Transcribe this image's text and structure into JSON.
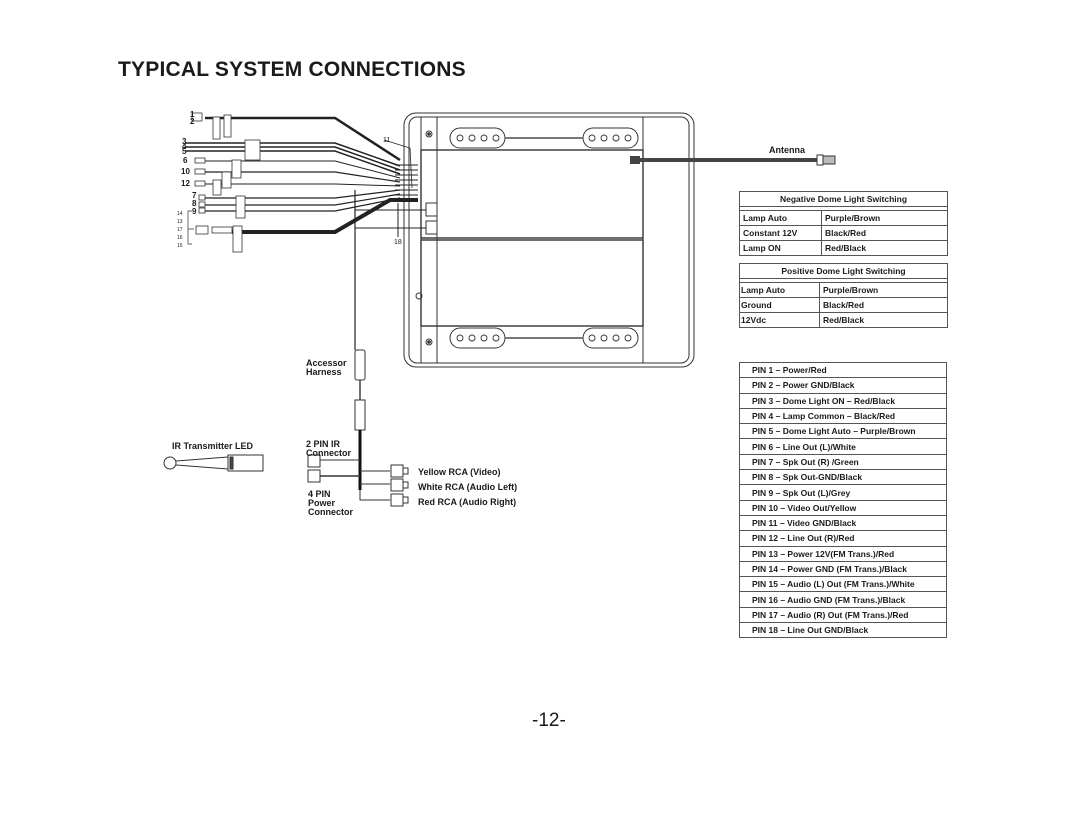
{
  "page": {
    "title": "TYPICAL SYSTEM CONNECTIONS",
    "page_number": "-12-"
  },
  "harness_labels": {
    "pins_left": [
      "1",
      "2",
      "3",
      "4",
      "5",
      "6",
      "10",
      "12",
      "7",
      "8",
      "9"
    ],
    "fm_group_pins": [
      "14",
      "13",
      "17",
      "16",
      "15"
    ],
    "pin_11": "11",
    "pin_18": "18"
  },
  "antenna": {
    "label": "Antenna"
  },
  "accessory": {
    "harness_label_line1": "Accessor",
    "harness_label_line2": "Harness",
    "ir_connector_line1": "2 PIN IR",
    "ir_connector_line2": "Connector",
    "power_connector_line1": "4 PIN",
    "power_connector_line2": "Power",
    "power_connector_line3": "Connector",
    "rca": [
      "Yellow RCA (Video)",
      "White RCA (Audio Left)",
      "Red RCA (Audio Right)"
    ],
    "ir_led_label": "IR Transmitter LED"
  },
  "negative_dome": {
    "header": "Negative Dome Light Switching",
    "rows": [
      {
        "name": "Lamp Auto",
        "wire": "Purple/Brown"
      },
      {
        "name": "Constant 12V",
        "wire": "Black/Red"
      },
      {
        "name": "Lamp ON",
        "wire": "Red/Black"
      }
    ]
  },
  "positive_dome": {
    "header": "Positive Dome Light Switching",
    "rows": [
      {
        "name": "Lamp Auto",
        "wire": "Purple/Brown"
      },
      {
        "name": "Ground",
        "wire": "Black/Red"
      },
      {
        "name": "12Vdc",
        "wire": "Red/Black"
      }
    ]
  },
  "pin_list": [
    "PIN  1 –  Power/Red",
    "PIN  2 –  Power GND/Black",
    "PIN  3 –  Dome Light ON – Red/Black",
    "PIN  4 –  Lamp Common – Black/Red",
    "PIN  5 –  Dome Light Auto – Purple/Brown",
    "PIN  6 –  Line Out (L)/White",
    "PIN  7 –  Spk Out (R) /Green",
    "PIN  8 –  Spk Out-GND/Black",
    "PIN  9 –  Spk Out (L)/Grey",
    "PIN 10 –  Video Out/Yellow",
    "PIN 11 –  Video GND/Black",
    "PIN 12 –  Line Out (R)/Red",
    "PIN 13 –  Power 12V(FM Trans.)/Red",
    "PIN 14 –  Power GND (FM Trans.)/Black",
    "PIN 15 –  Audio (L) Out (FM Trans.)/White",
    "PIN 16 –  Audio GND (FM Trans.)/Black",
    "PIN 17 –  Audio (R) Out (FM Trans.)/Red",
    "PIN 18 –  Line Out GND/Black"
  ]
}
